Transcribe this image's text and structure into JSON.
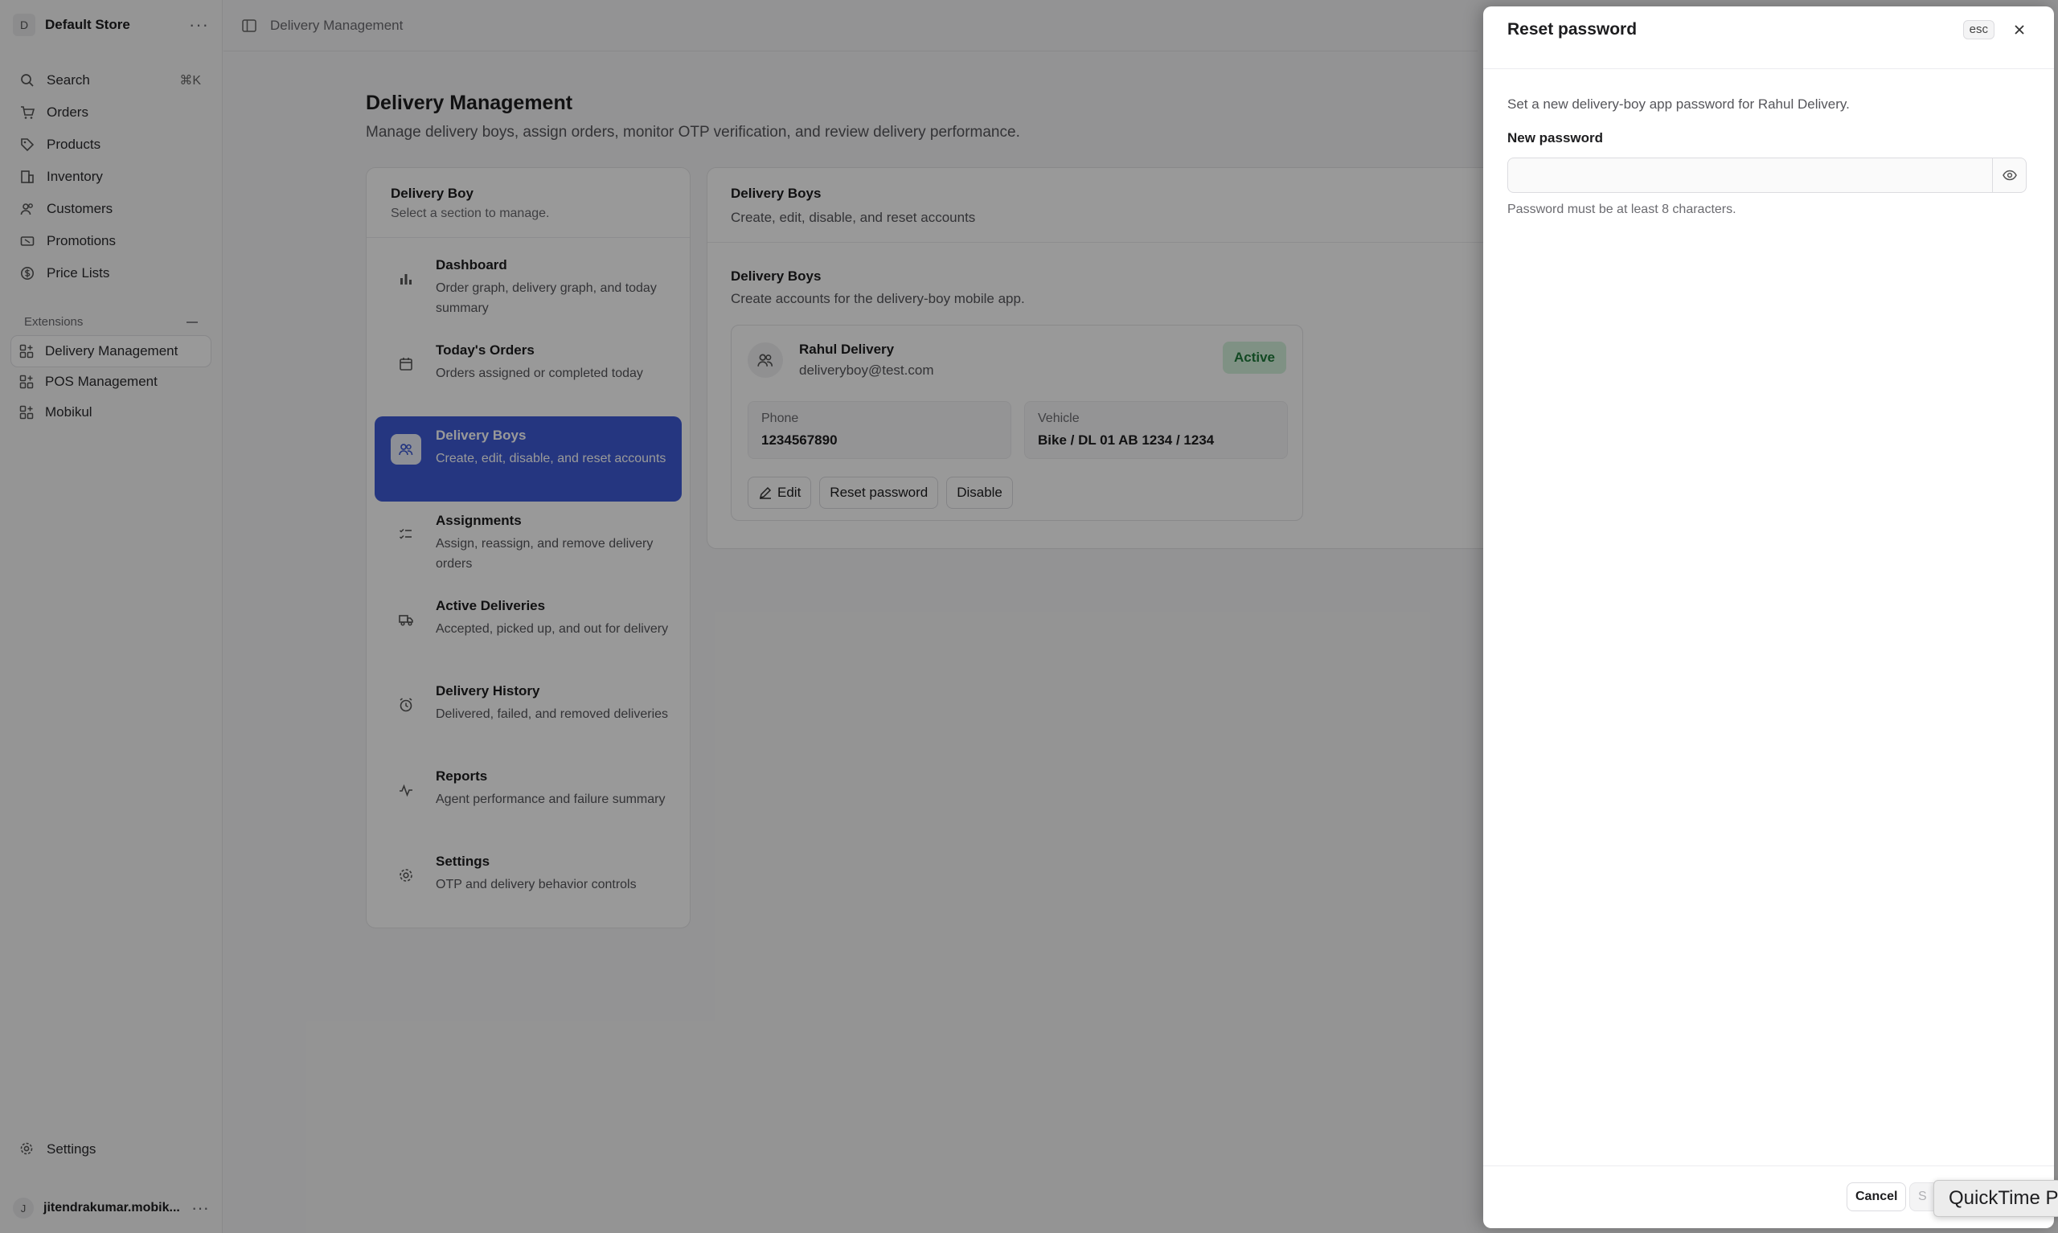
{
  "sidebar": {
    "store_initial": "D",
    "store_name": "Default Store",
    "more": "···",
    "nav": [
      {
        "label": "Search",
        "shortcut": "⌘K",
        "icon": "search-icon"
      },
      {
        "label": "Orders",
        "icon": "cart-icon"
      },
      {
        "label": "Products",
        "icon": "tag-icon"
      },
      {
        "label": "Inventory",
        "icon": "building-icon"
      },
      {
        "label": "Customers",
        "icon": "users-icon"
      },
      {
        "label": "Promotions",
        "icon": "ticket-icon"
      },
      {
        "label": "Price Lists",
        "icon": "currency-icon"
      }
    ],
    "extensions_label": "Extensions",
    "extensions": [
      {
        "label": "Delivery Management",
        "icon": "grid-plus-icon"
      },
      {
        "label": "POS Management",
        "icon": "grid-plus-icon"
      },
      {
        "label": "Mobikul",
        "icon": "grid-plus-icon"
      }
    ],
    "settings_label": "Settings",
    "user_initial": "J",
    "user_name": "jitendrakumar.mobik..."
  },
  "topbar": {
    "breadcrumb": "Delivery Management"
  },
  "page": {
    "title": "Delivery Management",
    "subtitle": "Manage delivery boys, assign orders, monitor OTP verification, and review delivery performance."
  },
  "menu": {
    "title": "Delivery Boy",
    "subtitle": "Select a section to manage.",
    "items": [
      {
        "title": "Dashboard",
        "desc": "Order graph, delivery graph, and today summary",
        "icon": "bar-chart-icon"
      },
      {
        "title": "Today's Orders",
        "desc": "Orders assigned or completed today",
        "icon": "calendar-icon"
      },
      {
        "title": "Delivery Boys",
        "desc": "Create, edit, disable, and reset accounts",
        "icon": "users-icon"
      },
      {
        "title": "Assignments",
        "desc": "Assign, reassign, and remove delivery orders",
        "icon": "checklist-icon"
      },
      {
        "title": "Active Deliveries",
        "desc": "Accepted, picked up, and out for delivery",
        "icon": "truck-icon"
      },
      {
        "title": "Delivery History",
        "desc": "Delivered, failed, and removed deliveries",
        "icon": "clock-icon"
      },
      {
        "title": "Reports",
        "desc": "Agent performance and failure summary",
        "icon": "activity-icon"
      },
      {
        "title": "Settings",
        "desc": "OTP and delivery behavior controls",
        "icon": "gear-icon"
      }
    ]
  },
  "content": {
    "title": "Delivery Boys",
    "subtitle": "Create, edit, disable, and reset accounts",
    "section_title": "Delivery Boys",
    "section_subtitle": "Create accounts for the delivery-boy mobile app.",
    "boy": {
      "name": "Rahul Delivery",
      "email": "deliveryboy@test.com",
      "status": "Active",
      "phone_label": "Phone",
      "phone": "1234567890",
      "vehicle_label": "Vehicle",
      "vehicle": "Bike / DL 01 AB 1234 / 1234",
      "edit_label": "Edit",
      "reset_label": "Reset password",
      "disable_label": "Disable"
    }
  },
  "drawer": {
    "title": "Reset password",
    "esc": "esc",
    "description": "Set a new delivery-boy app password for Rahul Delivery.",
    "field_label": "New password",
    "field_value": "",
    "hint": "Password must be at least 8 characters.",
    "cancel_label": "Cancel",
    "save_label": "S"
  },
  "tooltip": {
    "text": "QuickTime P"
  }
}
